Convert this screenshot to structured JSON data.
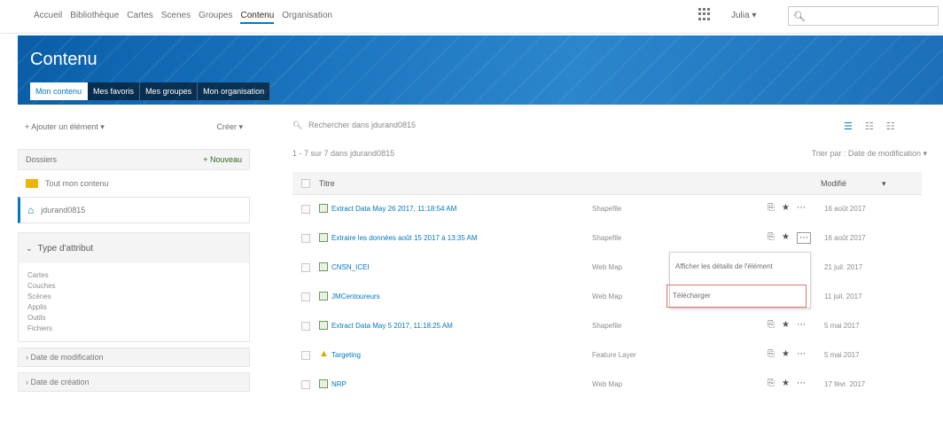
{
  "topnav": {
    "links": [
      "Accueil",
      "Bibliothèque",
      "Cartes",
      "Scenes",
      "Groupes",
      "Contenu",
      "Organisation"
    ],
    "active_link": "Contenu",
    "user": "Julia ▾",
    "search_icon": "search-icon"
  },
  "banner": {
    "title": "Contenu",
    "tabs": [
      "Mon contenu",
      "Mes favoris",
      "Mes groupes",
      "Mon organisation"
    ],
    "active_tab": "Mon contenu"
  },
  "sidebar": {
    "add_item": "+ Ajouter un élément ▾",
    "create": "Créer ▾",
    "folders_label": "Dossiers",
    "new_folder": "+ Nouveau",
    "folders": [
      {
        "label": "Tout mon contenu",
        "icon": "folder-icon"
      },
      {
        "label": "jdurand0815",
        "icon": "home-icon"
      }
    ],
    "filter_title": "Type d'attribut",
    "filter_items": [
      "Cartes",
      "Couches",
      "Scènes",
      "Applis",
      "Outils",
      "Fichiers"
    ],
    "collapsed": [
      "Date de modification",
      "Date de création"
    ]
  },
  "main": {
    "search_placeholder": "Rechercher dans jdurand0815",
    "count": "1 - 7 sur 7 dans jdurand0815",
    "sort": "Trier par : Date de modification ▾",
    "header_title": "Titre",
    "header_modified": "Modifié",
    "rows": [
      {
        "title": "Extract Data May 26 2017, 11:18:54 AM",
        "type": "Shapefile",
        "date": "16 août 2017"
      },
      {
        "title": "Extraire les données août 15 2017 à 13:35 AM",
        "type": "Shapefile",
        "date": "16 août 2017"
      },
      {
        "title": "CNSN_ICEI",
        "type": "Web Map",
        "date": "21 juil. 2017"
      },
      {
        "title": "JMCentoureurs",
        "type": "Web Map",
        "date": "11 juil. 2017"
      },
      {
        "title": "Extract Data May 5 2017, 11:18:25 AM",
        "type": "Shapefile",
        "date": "5 mai 2017"
      },
      {
        "title": "Targeting",
        "type": "Feature Layer",
        "date": "5 mai 2017"
      },
      {
        "title": "NRP",
        "type": "Web Map",
        "date": "17 févr. 2017"
      }
    ],
    "view_icons": [
      "table-view-icon",
      "list-view-icon",
      "grid-view-icon"
    ]
  },
  "context_menu": {
    "details": "Afficher les détails de l'élément",
    "download": "Télécharger"
  },
  "colors": {
    "accent": "#0079c1",
    "banner": "#1b6fb9",
    "highlight": "#e57373"
  }
}
